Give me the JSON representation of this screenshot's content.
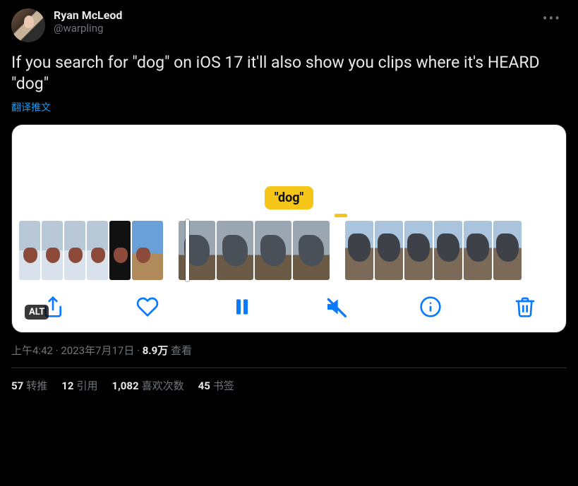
{
  "user": {
    "display_name": "Ryan McLeod",
    "handle": "@warpling"
  },
  "tweet_text": "If you search for \"dog\" on iOS 17 it'll also show you clips where it's HEARD \"dog\"",
  "translate_label": "翻译推文",
  "media": {
    "caption_pill": "\"dog\"",
    "alt_badge": "ALT",
    "toolbar": {
      "share": "share-icon",
      "like": "heart-icon",
      "pause": "pause-icon",
      "mute": "mute-icon",
      "info": "info-icon",
      "delete": "trash-icon"
    }
  },
  "meta": {
    "time": "上午4:42",
    "sep": " · ",
    "date": "2023年7月17日",
    "views_num": "8.9万",
    "views_label": " 查看"
  },
  "stats": {
    "retweets": {
      "num": "57",
      "label": "转推"
    },
    "quotes": {
      "num": "12",
      "label": "引用"
    },
    "likes": {
      "num": "1,082",
      "label": "喜欢次数"
    },
    "bookmarks": {
      "num": "45",
      "label": "书签"
    }
  }
}
